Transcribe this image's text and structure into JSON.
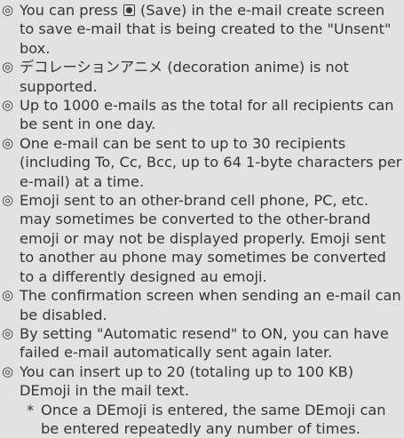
{
  "notes": [
    {
      "mark": "◎",
      "before": "You can press",
      "icon": "save-key-icon",
      "after": "(Save) in the e-mail create screen to save e-mail that is being created to the \"Unsent\" box."
    },
    {
      "mark": "◎",
      "text": "デコレーションアニメ (decoration anime) is not supported."
    },
    {
      "mark": "◎",
      "text": "Up to 1000 e-mails as the total for all recipients can be sent in one day."
    },
    {
      "mark": "◎",
      "text": "One e-mail can be sent to up to 30 recipients (including To, Cc, Bcc, up to 64 1-byte characters per e-mail) at a time."
    },
    {
      "mark": "◎",
      "text": "Emoji sent to an other-brand cell phone, PC, etc. may sometimes be converted to the other-brand emoji or may not be displayed properly. Emoji sent to another au phone may sometimes be converted to a differently designed au emoji."
    },
    {
      "mark": "◎",
      "text": "The confirmation screen when sending an e-mail can be disabled."
    },
    {
      "mark": "◎",
      "text": "By setting \"Automatic resend\" to ON, you can have failed e-mail automatically sent again later."
    },
    {
      "mark": "◎",
      "text": "You can insert up to 20 (totaling up to 100 KB) DEmoji in the mail text."
    }
  ],
  "subnote": {
    "mark": "*",
    "text": "Once a DEmoji is entered, the same DEmoji can be entered repeatedly any number of times."
  }
}
